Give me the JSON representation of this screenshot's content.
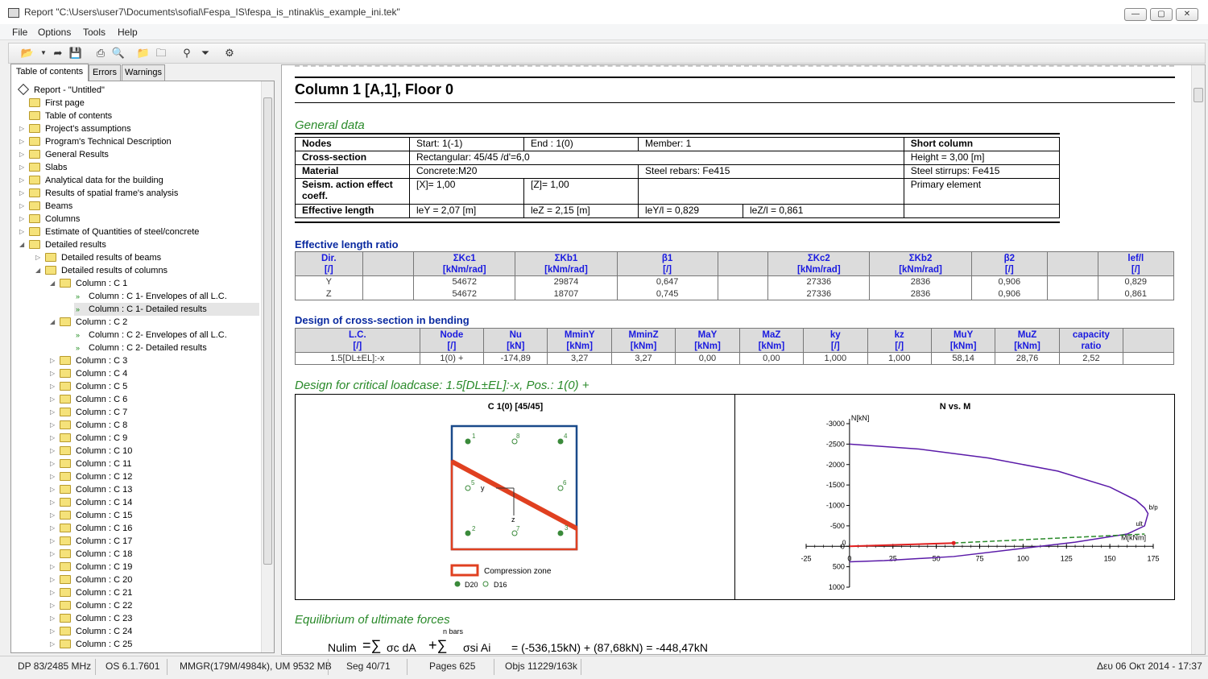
{
  "window": {
    "title": "Report \"C:\\Users\\user7\\Documents\\sofial\\Fespa_IS\\fespa_is_ntinak\\is_example_ini.tek\""
  },
  "menu": [
    "File",
    "Options",
    "Tools",
    "Help"
  ],
  "tabs": [
    "Table of contents",
    "Errors",
    "Warnings"
  ],
  "tree": [
    {
      "label": "Report - \"Untitled\"",
      "level": 0,
      "icon": "diamond"
    },
    {
      "label": "First page",
      "level": 1,
      "icon": "folder"
    },
    {
      "label": "Table of contents",
      "level": 1,
      "icon": "folder"
    },
    {
      "label": "Project's assumptions",
      "level": 1,
      "icon": "folder",
      "exp": "▷"
    },
    {
      "label": "Program's Technical Description",
      "level": 1,
      "icon": "folder",
      "exp": "▷"
    },
    {
      "label": "General Results",
      "level": 1,
      "icon": "folder",
      "exp": "▷"
    },
    {
      "label": "Slabs",
      "level": 1,
      "icon": "folder",
      "exp": "▷"
    },
    {
      "label": "Analytical data for the building",
      "level": 1,
      "icon": "folder",
      "exp": "▷"
    },
    {
      "label": "Results of spatial frame's analysis",
      "level": 1,
      "icon": "folder",
      "exp": "▷"
    },
    {
      "label": "Beams",
      "level": 1,
      "icon": "folder",
      "exp": "▷"
    },
    {
      "label": "Columns",
      "level": 1,
      "icon": "folder",
      "exp": "▷"
    },
    {
      "label": "Estimate of Quantities of steel/concrete",
      "level": 1,
      "icon": "folder",
      "exp": "▷"
    },
    {
      "label": "Detailed results",
      "level": 1,
      "icon": "folder",
      "exp": "◢"
    },
    {
      "label": "Detailed results of beams",
      "level": 2,
      "icon": "folder",
      "exp": "▷"
    },
    {
      "label": "Detailed results of columns",
      "level": 2,
      "icon": "folder",
      "exp": "◢"
    },
    {
      "label": "Column : C 1",
      "level": 3,
      "icon": "folder",
      "exp": "◢"
    },
    {
      "label": "Column : C 1- Envelopes of all L.C.",
      "level": 4,
      "icon": "leaf"
    },
    {
      "label": "Column : C 1- Detailed results",
      "level": 4,
      "icon": "leaf",
      "selected": true
    },
    {
      "label": "Column : C 2",
      "level": 3,
      "icon": "folder",
      "exp": "◢"
    },
    {
      "label": "Column : C 2- Envelopes of all L.C.",
      "level": 4,
      "icon": "leaf"
    },
    {
      "label": "Column : C 2- Detailed results",
      "level": 4,
      "icon": "leaf"
    },
    {
      "label": "Column : C 3",
      "level": 3,
      "icon": "folder",
      "exp": "▷"
    },
    {
      "label": "Column : C 4",
      "level": 3,
      "icon": "folder",
      "exp": "▷"
    },
    {
      "label": "Column : C 5",
      "level": 3,
      "icon": "folder",
      "exp": "▷"
    },
    {
      "label": "Column : C 6",
      "level": 3,
      "icon": "folder",
      "exp": "▷"
    },
    {
      "label": "Column : C 7",
      "level": 3,
      "icon": "folder",
      "exp": "▷"
    },
    {
      "label": "Column : C 8",
      "level": 3,
      "icon": "folder",
      "exp": "▷"
    },
    {
      "label": "Column : C 9",
      "level": 3,
      "icon": "folder",
      "exp": "▷"
    },
    {
      "label": "Column : C 10",
      "level": 3,
      "icon": "folder",
      "exp": "▷"
    },
    {
      "label": "Column : C 11",
      "level": 3,
      "icon": "folder",
      "exp": "▷"
    },
    {
      "label": "Column : C 12",
      "level": 3,
      "icon": "folder",
      "exp": "▷"
    },
    {
      "label": "Column : C 13",
      "level": 3,
      "icon": "folder",
      "exp": "▷"
    },
    {
      "label": "Column : C 14",
      "level": 3,
      "icon": "folder",
      "exp": "▷"
    },
    {
      "label": "Column : C 15",
      "level": 3,
      "icon": "folder",
      "exp": "▷"
    },
    {
      "label": "Column : C 16",
      "level": 3,
      "icon": "folder",
      "exp": "▷"
    },
    {
      "label": "Column : C 17",
      "level": 3,
      "icon": "folder",
      "exp": "▷"
    },
    {
      "label": "Column : C 18",
      "level": 3,
      "icon": "folder",
      "exp": "▷"
    },
    {
      "label": "Column : C 19",
      "level": 3,
      "icon": "folder",
      "exp": "▷"
    },
    {
      "label": "Column : C 20",
      "level": 3,
      "icon": "folder",
      "exp": "▷"
    },
    {
      "label": "Column : C 21",
      "level": 3,
      "icon": "folder",
      "exp": "▷"
    },
    {
      "label": "Column : C 22",
      "level": 3,
      "icon": "folder",
      "exp": "▷"
    },
    {
      "label": "Column : C 23",
      "level": 3,
      "icon": "folder",
      "exp": "▷"
    },
    {
      "label": "Column : C 24",
      "level": 3,
      "icon": "folder",
      "exp": "▷"
    },
    {
      "label": "Column : C 25",
      "level": 3,
      "icon": "folder",
      "exp": "▷"
    }
  ],
  "doc": {
    "title": "Column 1 [A,1], Floor 0",
    "sec_general": "General data",
    "general": {
      "r1": [
        "Nodes",
        "Start: 1(-1)",
        "End : 1(0)",
        "Member: 1",
        "Short column"
      ],
      "r2": [
        "Cross-section",
        "Rectangular: 45/45 /d'=6,0",
        "Height = 3,00 [m]"
      ],
      "r3": [
        "Material",
        "Concrete:M20",
        "Steel rebars: Fe415",
        "Steel stirrups: Fe415"
      ],
      "r4": [
        "Seism. action effect coeff.",
        "[X]= 1,00",
        "[Z]= 1,00",
        "Primary element"
      ],
      "r5": [
        "Effective length",
        "leY = 2,07 [m]",
        "leZ = 2,15 [m]",
        "leY/l = 0,829",
        "leZ/l = 0,861"
      ]
    },
    "sec_elr": "Effective length ratio",
    "elr": {
      "headers": [
        [
          "Dir.",
          "[/]"
        ],
        [
          "",
          ""
        ],
        [
          "ΣKc1",
          "[kNm/rad]"
        ],
        [
          "ΣKb1",
          "[kNm/rad]"
        ],
        [
          "β1",
          "[/]"
        ],
        [
          "",
          ""
        ],
        [
          "ΣKc2",
          "[kNm/rad]"
        ],
        [
          "ΣKb2",
          "[kNm/rad]"
        ],
        [
          "β2",
          "[/]"
        ],
        [
          "",
          ""
        ],
        [
          "lef/l",
          "[/]"
        ]
      ],
      "rows": [
        [
          "Y",
          "",
          "54672",
          "29874",
          "0,647",
          "",
          "27336",
          "2836",
          "0,906",
          "",
          "0,829"
        ],
        [
          "Z",
          "",
          "54672",
          "18707",
          "0,745",
          "",
          "27336",
          "2836",
          "0,906",
          "",
          "0,861"
        ]
      ]
    },
    "sec_bend": "Design of cross-section in bending",
    "bend": {
      "headers": [
        [
          "L.C.",
          "[/]"
        ],
        [
          "Node",
          "[/]"
        ],
        [
          "Nu",
          "[kN]"
        ],
        [
          "MminY",
          "[kNm]"
        ],
        [
          "MminZ",
          "[kNm]"
        ],
        [
          "MaY",
          "[kNm]"
        ],
        [
          "MaZ",
          "[kNm]"
        ],
        [
          "ky",
          "[/]"
        ],
        [
          "kz",
          "[/]"
        ],
        [
          "MuY",
          "[kNm]"
        ],
        [
          "MuZ",
          "[kNm]"
        ],
        [
          "capacity",
          "ratio"
        ],
        [
          "",
          ""
        ]
      ],
      "rows": [
        [
          "1.5[DL±EL]:-x",
          "1(0) +",
          "-174,89",
          "3,27",
          "3,27",
          "0,00",
          "0,00",
          "1,000",
          "1,000",
          "58,14",
          "28,76",
          "2,52",
          ""
        ]
      ]
    },
    "sec_crit": "Design for critical loadcase: 1.5[DL±EL]:-x, Pos.: 1(0) +",
    "section": {
      "title": "C 1(0) [45/45]",
      "bars": [
        "1",
        "8",
        "4",
        "5",
        "6",
        "2",
        "7",
        "3"
      ],
      "axis_y": "y",
      "axis_z": "z",
      "legend": "Compression zone",
      "leg_d20": "D20",
      "leg_d16": "D16"
    },
    "chart_data": {
      "type": "line",
      "title": "N vs. M",
      "ylabel": "N[kN]",
      "xlabel": "M[kNm]",
      "xlim": [
        -25,
        175
      ],
      "ylim": [
        -3000,
        1000
      ],
      "y_inverted": true,
      "xticks": [
        "-25",
        "0",
        "25",
        "50",
        "75",
        "100",
        "125",
        "150",
        "175"
      ],
      "yticks": [
        "-3000",
        "-2500",
        "-2000",
        "-1500",
        "-1000",
        "-500",
        "0",
        "500",
        "1000"
      ],
      "series": [
        {
          "name": "",
          "color": "#5a1aa8",
          "x": [
            0,
            40,
            80,
            120,
            150,
            165,
            170,
            172,
            170,
            160,
            130,
            100,
            60,
            20,
            0
          ],
          "y": [
            -2500,
            -2380,
            -2160,
            -1840,
            -1450,
            -1130,
            -940,
            -800,
            -500,
            -300,
            -100,
            50,
            250,
            350,
            380
          ]
        },
        {
          "name": "",
          "color": "#e02020",
          "x": [
            0,
            30,
            60
          ],
          "y": [
            0,
            -40,
            -80
          ]
        },
        {
          "name": "",
          "color": "#2a8a2a",
          "x": [
            60,
            100,
            140,
            170
          ],
          "y": [
            -80,
            -160,
            -240,
            -300
          ]
        }
      ],
      "annotations": [
        "b/p",
        "ult",
        "0"
      ]
    },
    "sec_eq": "Equilibrium of ultimate forces",
    "eq": {
      "lhs": "Nulim",
      "nbars": "n bars",
      "t1": "σc dA",
      "t2": "σsi Ai",
      "rhs": "= (-536,15kN) + (87,68kN) = -448,47kN"
    }
  },
  "status": [
    "DP 83/2485 MHz",
    "OS 6.1.7601",
    "MMGR(179M/4984k), UM 9532 MB",
    "Seg 40/71",
    "Pages 625",
    "Objs 11229/163k",
    "Δευ 06 Οκτ 2014 - 17:37"
  ]
}
